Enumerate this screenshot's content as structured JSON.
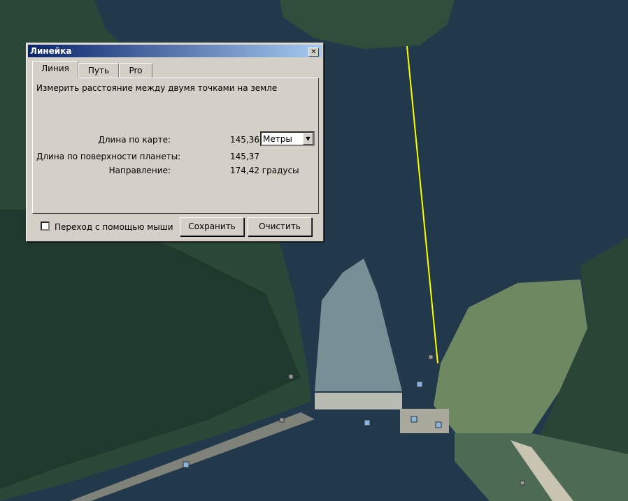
{
  "dialog": {
    "title": "Линейка",
    "close_glyph": "✕",
    "tabs": [
      {
        "label": "Линия",
        "active": true
      },
      {
        "label": "Путь",
        "active": false
      },
      {
        "label": "Pro",
        "active": false
      }
    ],
    "description": "Измерить расстояние между двумя точками на земле",
    "map_length_label": "Длина по карте:",
    "map_length_value": "145,36",
    "unit_selected": "Метры",
    "surface_length_label": "Длина по поверхности планеты:",
    "surface_length_value": "145,37",
    "direction_label": "Направление:",
    "direction_value": "174,42 градусы",
    "mouse_nav_label": "Переход с помощью мыши",
    "mouse_nav_checked": false,
    "save_label": "Сохранить",
    "clear_label": "Очистить"
  },
  "colors": {
    "water": "#25394a",
    "forest": "#2b4a3a",
    "grass": "#6f8a62",
    "measure_line": "#ffff00",
    "titlebar_start": "#0a246a",
    "titlebar_end": "#a6caf0"
  },
  "icons": [
    "close-icon",
    "dropdown-arrow-icon",
    "map-marker-icon"
  ]
}
